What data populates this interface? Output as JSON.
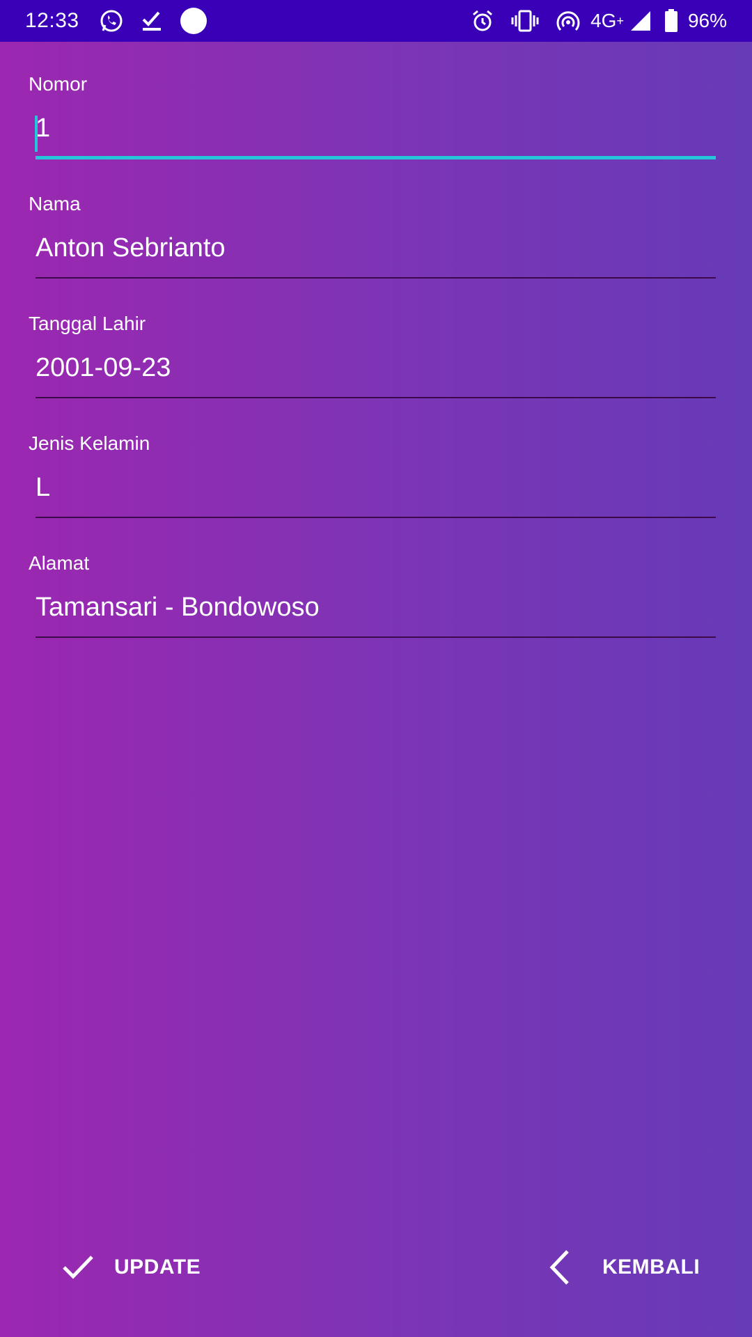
{
  "status_bar": {
    "time": "12:33",
    "network": "4G",
    "battery": "96%",
    "left_icons": [
      "whatsapp-icon",
      "task-check-icon",
      "circle-notification-icon"
    ],
    "right_icons": [
      "alarm-icon",
      "vibrate-icon",
      "hotspot-icon",
      "signal-icon",
      "battery-icon"
    ],
    "background_color": "#3a00b8"
  },
  "form": {
    "fields": [
      {
        "label": "Nomor",
        "value": "1",
        "focused": true
      },
      {
        "label": "Nama",
        "value": "Anton Sebrianto",
        "focused": false
      },
      {
        "label": "Tanggal Lahir",
        "value": "2001-09-23",
        "focused": false
      },
      {
        "label": "Jenis Kelamin",
        "value": "L",
        "focused": false
      },
      {
        "label": "Alamat",
        "value": "Tamansari - Bondowoso",
        "focused": false
      }
    ],
    "accent_color": "#26c6da"
  },
  "actions": {
    "update_label": "UPDATE",
    "back_label": "KEMBALI"
  },
  "theme": {
    "gradient_start": "#9c27b0",
    "gradient_end": "#673ab7"
  }
}
